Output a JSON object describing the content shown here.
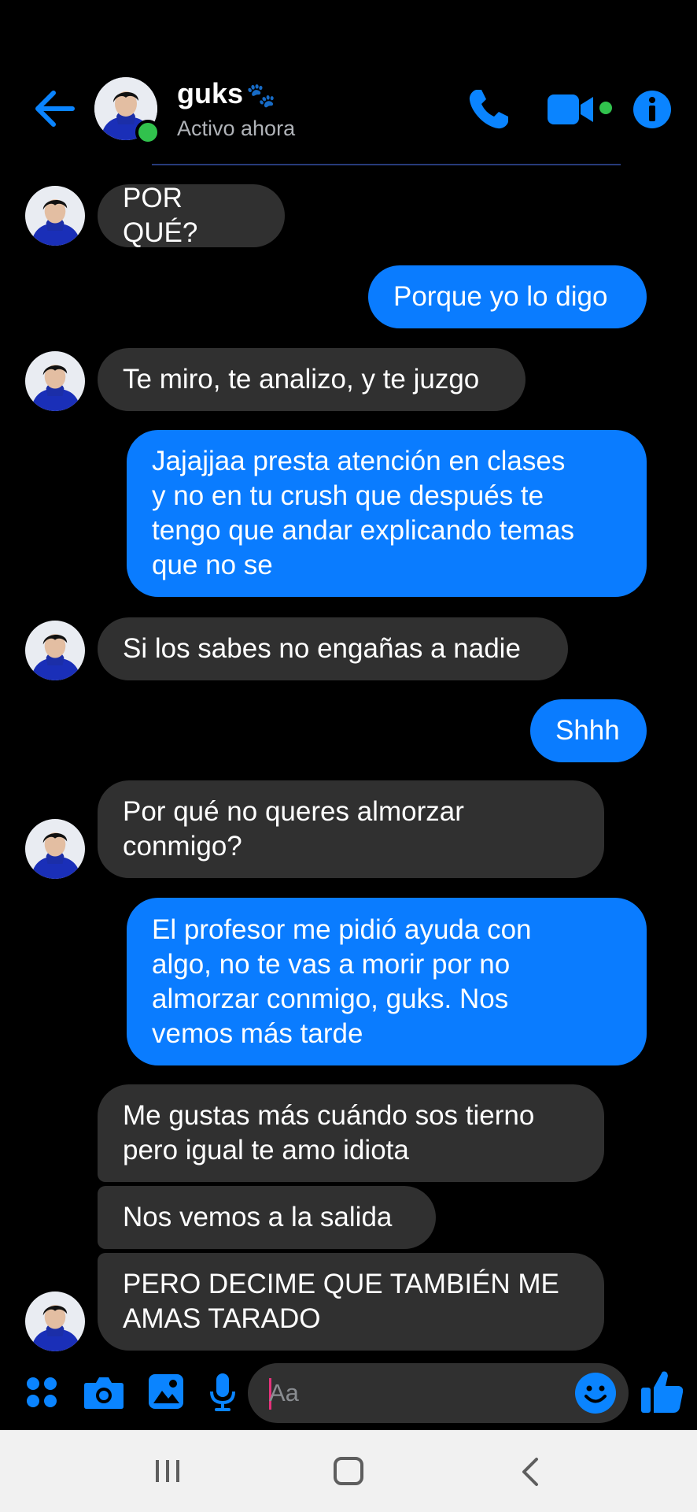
{
  "header": {
    "back_icon": "back-arrow-icon",
    "contact_name": "guks",
    "name_emoji": "🐾",
    "status": "Activo ahora",
    "call_icon": "phone-icon",
    "video_icon": "video-camera-icon",
    "info_icon": "info-icon"
  },
  "messages": [
    {
      "from": "them",
      "text": "POR QUÉ?"
    },
    {
      "from": "me",
      "text": "Porque yo lo digo"
    },
    {
      "from": "them",
      "text": "Te miro, te analizo, y te juzgo"
    },
    {
      "from": "me",
      "text": "Jajajjaa presta atención en clases\ny no en tu crush que después te\ntengo que andar explicando temas\nque no se"
    },
    {
      "from": "them",
      "text": "Si los sabes no engañas a nadie"
    },
    {
      "from": "me",
      "text": "Shhh"
    },
    {
      "from": "them",
      "text": "Por qué no queres almorzar\nconmigo?"
    },
    {
      "from": "me",
      "text": "El profesor me pidió ayuda con\nalgo, no te vas a morir por no\nalmorzar conmigo, guks. Nos\nvemos más tarde"
    },
    {
      "from": "them",
      "text": "Me gustas más cuándo sos tierno\npero igual te amo idiota"
    },
    {
      "from": "them",
      "text": "Nos vemos a la salida"
    },
    {
      "from": "them",
      "text": "PERO DECIME QUE TAMBIÉN ME\nAMAS TARADO"
    }
  ],
  "composer": {
    "placeholder": "Aa",
    "apps_icon": "apps-grid-icon",
    "camera_icon": "camera-icon",
    "gallery_icon": "image-icon",
    "mic_icon": "microphone-icon",
    "emoji_icon": "emoji-icon",
    "like_icon": "thumbs-up-icon"
  },
  "colors": {
    "accent": "#0a7cff",
    "incoming_bubble": "#303030",
    "online": "#31c24d",
    "background": "#000000"
  }
}
